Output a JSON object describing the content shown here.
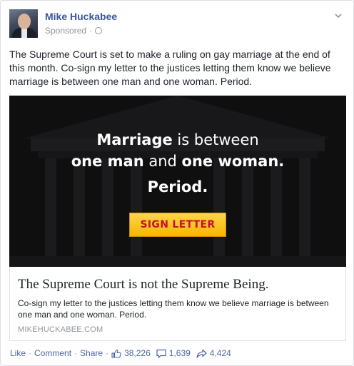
{
  "post": {
    "author": "Mike Huckabee",
    "sponsored_label": "Sponsored",
    "meta_separator": "·",
    "text": "The Supreme Court is set to make a ruling on gay marriage at the end of this month. Co-sign my letter to the justices letting them know we believe marriage is between one man and one woman. Period.",
    "icons": {
      "audience": "globe-icon",
      "options": "chevron-down-icon"
    }
  },
  "hero": {
    "line1_bold": "Marriage",
    "line1_rest": " is between",
    "line2_bold_a": "one man",
    "line2_mid": " and ",
    "line2_bold_b": "one woman.",
    "line3": "Period.",
    "button_label": "SIGN LETTER",
    "button_color": "#f5b800",
    "button_text_color": "#c8102e"
  },
  "link": {
    "title": "The Supreme Court is not the Supreme Being.",
    "description": "Co-sign my letter to the justices letting them know we believe marriage is between one man and one woman. Period.",
    "domain": "MIKEHUCKABEE.COM"
  },
  "actions": {
    "like": "Like",
    "comment": "Comment",
    "share": "Share",
    "separator": "·",
    "likes_count": "38,226",
    "comments_count": "1,639",
    "shares_count": "4,424",
    "link_color": "#4b67a1"
  }
}
